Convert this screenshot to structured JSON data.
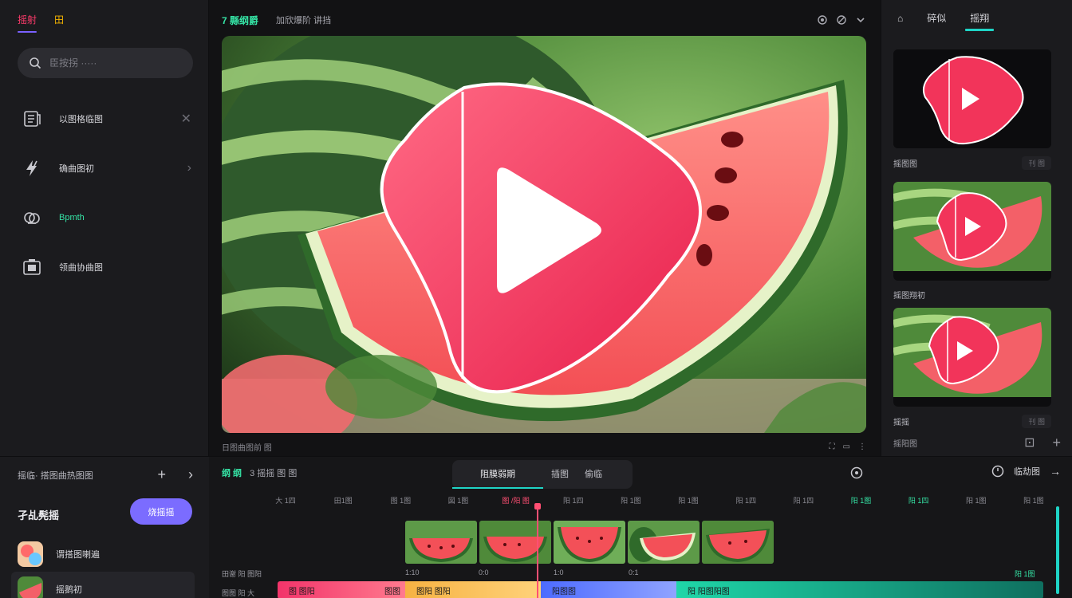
{
  "left_panel": {
    "tabs": [
      {
        "label": "摇射"
      },
      {
        "label": "田"
      }
    ],
    "search": {
      "placeholder": "臣按拐 ·····"
    },
    "menu": [
      {
        "label": "以图格临图",
        "icon": "document-list-icon",
        "trail": "✕"
      },
      {
        "label": "确曲图初",
        "icon": "lightning-icon",
        "trail": "›"
      },
      {
        "label": "Bpmth",
        "icon": "cloud-sync-icon",
        "trail": ""
      },
      {
        "label": "领曲协曲图",
        "icon": "camera-frame-icon",
        "trail": ""
      }
    ]
  },
  "preview": {
    "title": "7 縣纲爵",
    "subtitle": "加欣爆阶  讲挡",
    "footer_left": "日图曲图前  图",
    "accent_colors": {
      "play_badge": "#f2345a",
      "play_badge_light": "#ff5c7a",
      "green": "#35e3a5",
      "teal": "#1fd4c6",
      "purple": "#7b6cff"
    }
  },
  "right_panel": {
    "tabs": [
      {
        "label": "⌂"
      },
      {
        "label": "碎似"
      },
      {
        "label": "摇翔"
      }
    ],
    "cards": [
      {
        "caption": "摇图图",
        "chip": "刊 图"
      },
      {
        "caption": "摇图翔初",
        "chip": ""
      },
      {
        "caption": "摇摇",
        "chip": "刊 图"
      }
    ],
    "footer_label": "摇阳图"
  },
  "bottom_left": {
    "header": "摇临·  搭图曲热图图",
    "title": "孑乩髡摇",
    "button_label": "烧摇摇",
    "list": [
      {
        "label": "谓搭图喇遍"
      },
      {
        "label": "摇鹅初"
      }
    ]
  },
  "timeline": {
    "left_label_green": "纲 纲",
    "left_label_rest": "3  摇摇  图  图",
    "tabs": [
      {
        "label": "阻膜弱期"
      },
      {
        "label": "插图"
      },
      {
        "label": "偷临"
      }
    ],
    "right_label": "临劫图",
    "ruler": [
      {
        "label": "大 1四"
      },
      {
        "label": "田1图"
      },
      {
        "label": "图 1图"
      },
      {
        "label": "図 1图"
      },
      {
        "label": "图 /阳 图"
      },
      {
        "label": "阳 1四"
      },
      {
        "label": "阳 1图"
      },
      {
        "label": "阳 1图"
      },
      {
        "label": "阳 1四"
      },
      {
        "label": "阳 1四"
      },
      {
        "label": "阳 1图"
      },
      {
        "label": "阳 1四"
      },
      {
        "label": "阳 1图"
      },
      {
        "label": "阳 1图"
      }
    ],
    "track_labels": [
      "田谢 阳 图阳",
      "图图 阳  大"
    ],
    "clip_labels": [
      "1:10",
      "0:0",
      "1:0",
      "0:1",
      "阳 1图"
    ],
    "segments": [
      {
        "label": "图 图阳",
        "label2": "图图",
        "color": "#f2346a"
      },
      {
        "label": "图阳 图阳",
        "color": "#f6b243"
      },
      {
        "label": "阳图图",
        "color": "#4d6bff"
      },
      {
        "label": "阳 阳图阳图",
        "color": "#1fd6a8"
      }
    ]
  }
}
